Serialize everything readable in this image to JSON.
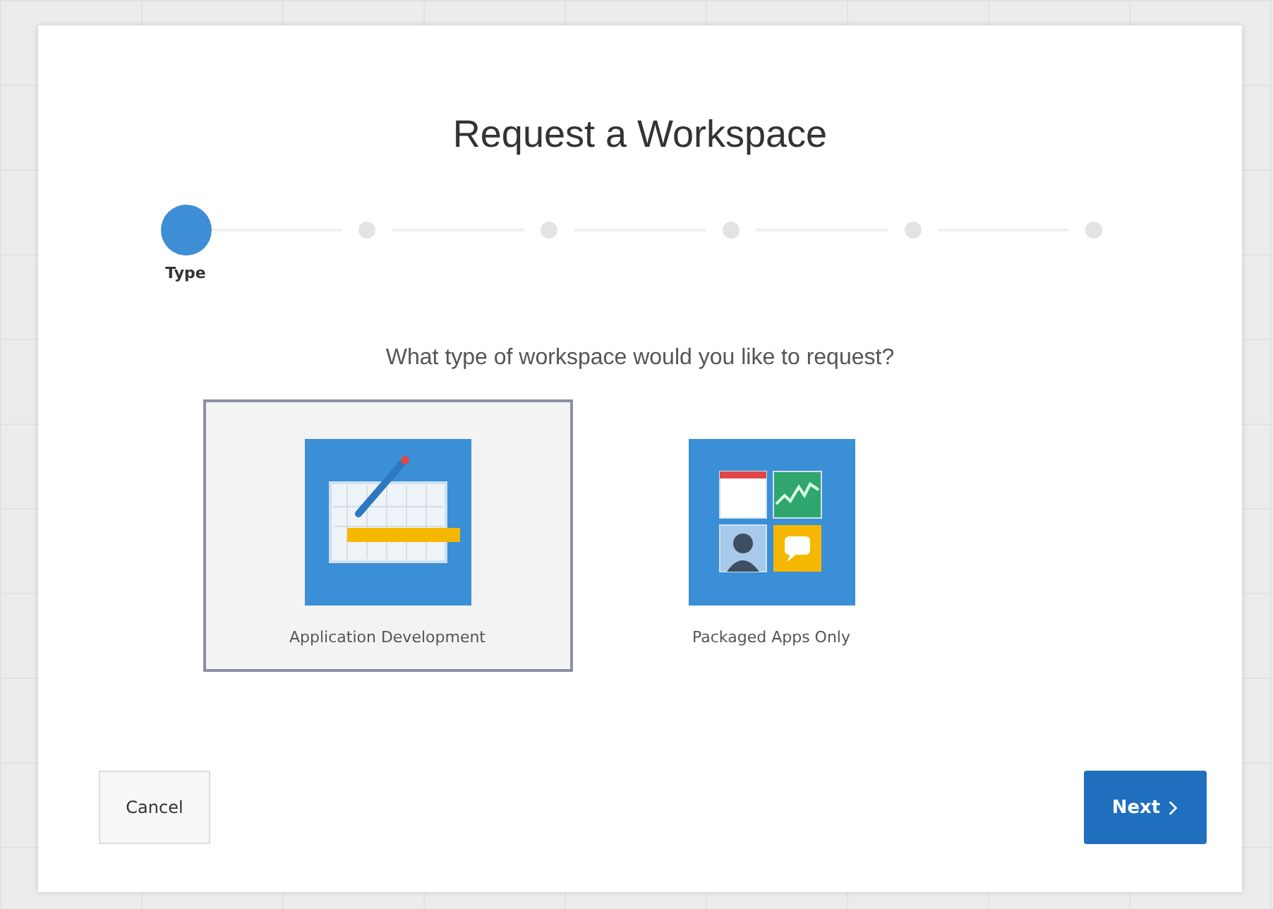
{
  "dialog": {
    "title": "Request a Workspace"
  },
  "steps": [
    {
      "label": "Type",
      "selected": true
    },
    {
      "selected": false
    },
    {
      "selected": false
    },
    {
      "selected": false
    },
    {
      "selected": false
    },
    {
      "selected": false
    }
  ],
  "question": "What type of workspace would you like to request?",
  "options": [
    {
      "kind": "app-development",
      "label": "Application Development",
      "selected": true
    },
    {
      "kind": "packaged-apps",
      "label": "Packaged Apps Only",
      "selected": false
    }
  ],
  "buttons": {
    "cancel": "Cancel",
    "next": "Next"
  }
}
